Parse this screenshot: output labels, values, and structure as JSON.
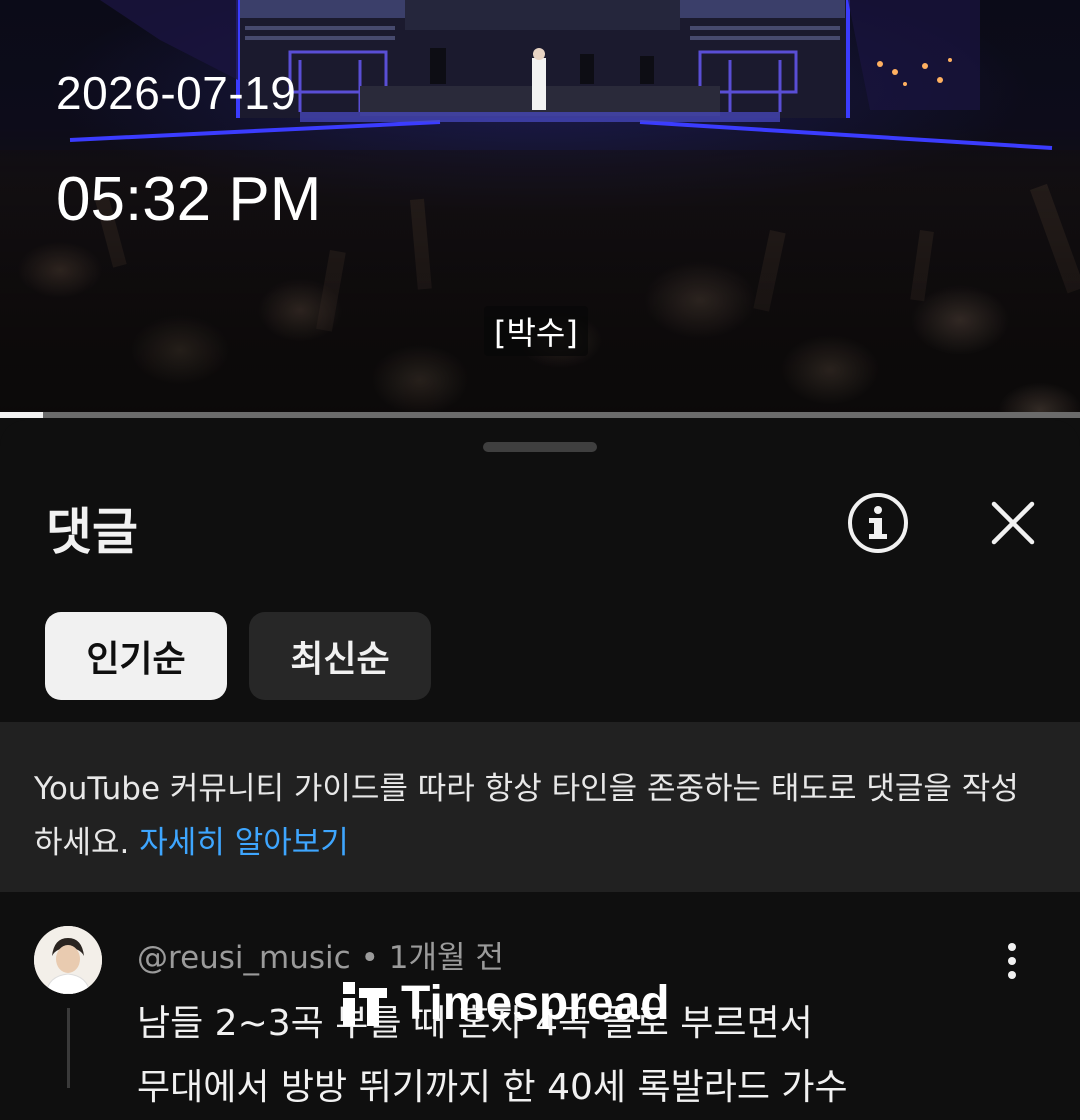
{
  "video": {
    "date": "2026-07-19",
    "time": "05:32 PM",
    "caption": "[박수]",
    "progress": 0.04
  },
  "comments_sheet": {
    "title": "댓글",
    "info_icon": "info-circle-icon",
    "close_icon": "close-icon",
    "sort_chips": [
      {
        "label": "인기순",
        "selected": true
      },
      {
        "label": "최신순",
        "selected": false
      }
    ],
    "notice": {
      "text": "YouTube 커뮤니티 가이드를 따라 항상 타인을 존중하는 태도로 댓글을 작성하세요.",
      "link": "자세히 알아보기"
    },
    "comments": [
      {
        "author": "@reusi_music",
        "separator": "•",
        "age": "1개월 전",
        "lines": [
          "남들 2~3곡 부를 때 혼자 4곡 몰로 부르면서",
          "무대에서 방방 뛰기까지 한 40세 록발라드 가수"
        ]
      }
    ]
  },
  "watermark": {
    "text": "Timespread",
    "icon": "timespread-logo-icon"
  },
  "colors": {
    "background": "#0f0f0f",
    "link": "#3ea6ff",
    "chip_selected": "#f1f1f1",
    "chip_unselected": "#272727",
    "notice_bg": "#212121"
  }
}
